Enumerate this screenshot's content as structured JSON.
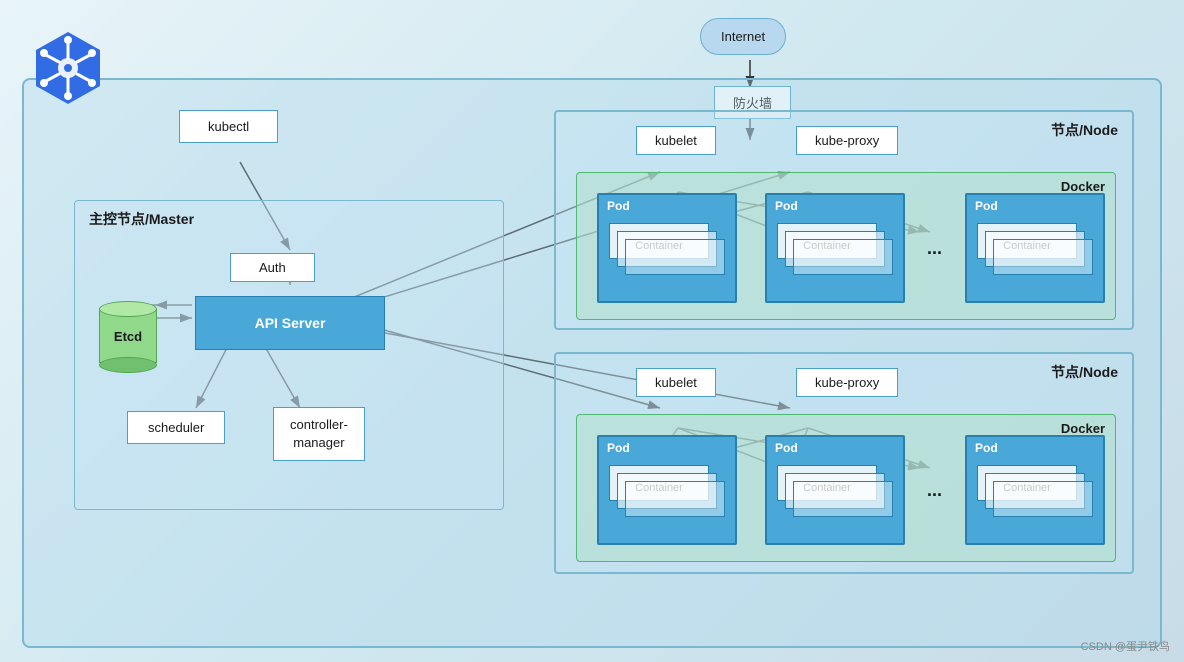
{
  "internet": {
    "label": "Internet"
  },
  "firewall": {
    "label": "防火墙"
  },
  "kubectl": {
    "label": "kubectl"
  },
  "master": {
    "label": "主控节点/Master"
  },
  "auth": {
    "label": "Auth"
  },
  "apiserver": {
    "label": "API Server"
  },
  "etcd": {
    "label": "Etcd"
  },
  "scheduler": {
    "label": "scheduler"
  },
  "controller": {
    "label": "controller-\nmanager"
  },
  "node1": {
    "label": "节点/Node"
  },
  "node2": {
    "label": "节点/Node"
  },
  "docker1": {
    "label": "Docker"
  },
  "docker2": {
    "label": "Docker"
  },
  "kubelet1": {
    "label": "kubelet"
  },
  "kubeproxy1": {
    "label": "kube-proxy"
  },
  "kubelet2": {
    "label": "kubelet"
  },
  "kubeproxy2": {
    "label": "kube-proxy"
  },
  "pod_label": "Pod",
  "container_label": "Container",
  "ellipsis": "...",
  "watermark": "CSDN @蛋尹铁鸟"
}
